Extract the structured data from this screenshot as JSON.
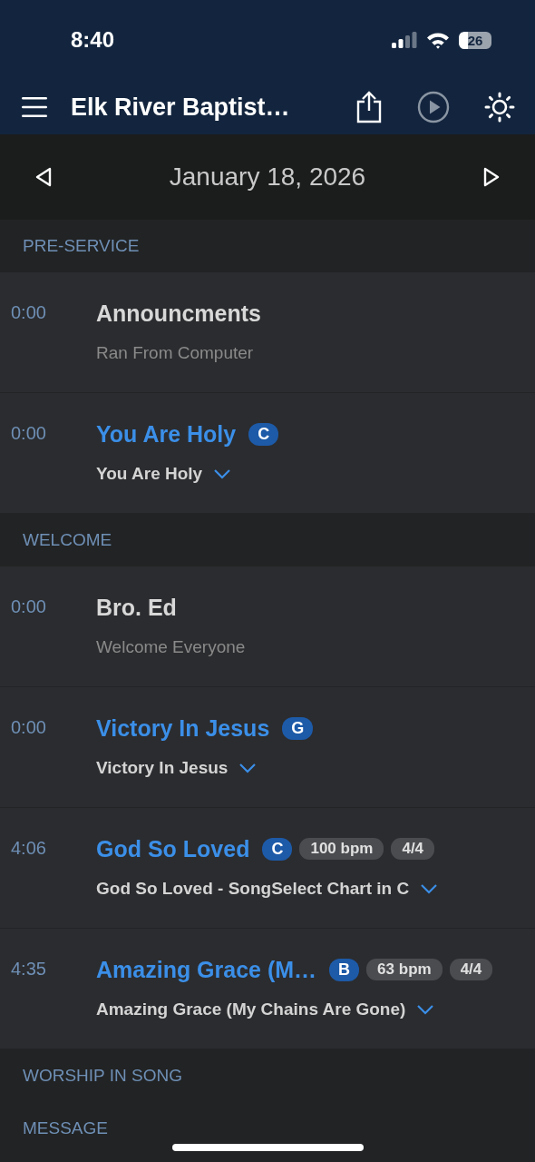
{
  "status_bar": {
    "time": "8:40",
    "battery": "26"
  },
  "nav_bar": {
    "title": "Elk River Baptist…"
  },
  "date_bar": {
    "date": "January 18, 2026"
  },
  "sections": [
    {
      "header": "PRE-SERVICE",
      "items": [
        {
          "kind": "note",
          "time": "0:00",
          "title": "Announcments",
          "subtitle": "Ran From Computer"
        },
        {
          "kind": "song",
          "time": "0:00",
          "title": "You Are Holy",
          "key": "C",
          "attachment": "You Are Holy"
        }
      ]
    },
    {
      "header": "WELCOME",
      "items": [
        {
          "kind": "note",
          "time": "0:00",
          "title": "Bro. Ed",
          "subtitle": "Welcome Everyone"
        },
        {
          "kind": "song",
          "time": "0:00",
          "title": "Victory In Jesus",
          "key": "G",
          "attachment": "Victory In Jesus"
        },
        {
          "kind": "song",
          "time": "4:06",
          "title": "God So Loved",
          "key": "C",
          "bpm": "100 bpm",
          "meter": "4/4",
          "attachment": "God So Loved - SongSelect Chart in C"
        },
        {
          "kind": "song",
          "time": "4:35",
          "title": "Amazing Grace (M…",
          "key": "B",
          "bpm": "63 bpm",
          "meter": "4/4",
          "attachment": "Amazing Grace (My Chains Are Gone)"
        }
      ]
    },
    {
      "header": "WORSHIP IN SONG"
    },
    {
      "header": "MESSAGE"
    }
  ]
}
